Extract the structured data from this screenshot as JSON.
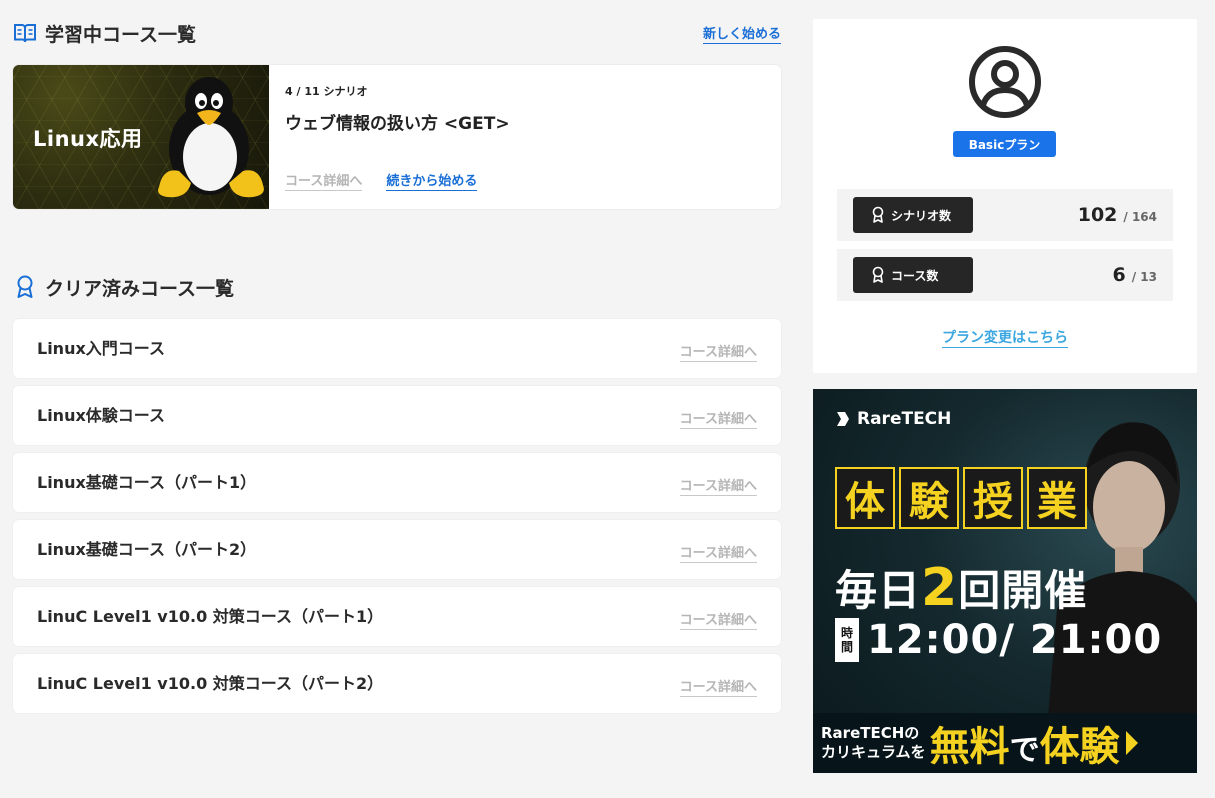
{
  "learning": {
    "title": "学習中コース一覧",
    "new_link": "新しく始める",
    "current": {
      "thumb_label": "Linux応用",
      "progress": "4 / 11 シナリオ",
      "title": "ウェブ情報の扱い方 <GET>",
      "detail_link": "コース詳細へ",
      "continue_link": "続きから始める"
    }
  },
  "cleared": {
    "title": "クリア済みコース一覧",
    "detail_label": "コース詳細へ",
    "courses": [
      "Linux入門コース",
      "Linux体験コース",
      "Linux基礎コース（パート1）",
      "Linux基礎コース（パート2）",
      "LinuC Level1 v10.0 対策コース（パート1）",
      "LinuC Level1 v10.0 対策コース（パート2）"
    ]
  },
  "profile": {
    "plan": "Basicプラン",
    "stats": [
      {
        "label": "シナリオ数",
        "value": "102",
        "total": "/ 164"
      },
      {
        "label": "コース数",
        "value": "6",
        "total": "/ 13"
      }
    ],
    "plan_change": "プラン変更はこちら"
  },
  "banner": {
    "brand": "RareTECH",
    "box_chars": [
      "体",
      "験",
      "授",
      "業"
    ],
    "daily_pre": "毎日",
    "daily_num": "2",
    "daily_post": "回開催",
    "time_tag_1": "時",
    "time_tag_2": "間",
    "times": "12:00/ 21:00",
    "bottom_line1": "RareTECHの",
    "bottom_line2": "カリキュラムを",
    "bottom_big1": "無料",
    "bottom_mid": "で",
    "bottom_big2": "体験"
  },
  "colors": {
    "accent": "#1a73e8",
    "link": "#1a6fd6",
    "plan_link": "#3ba6e0",
    "banner_yellow": "#f4d21f"
  }
}
